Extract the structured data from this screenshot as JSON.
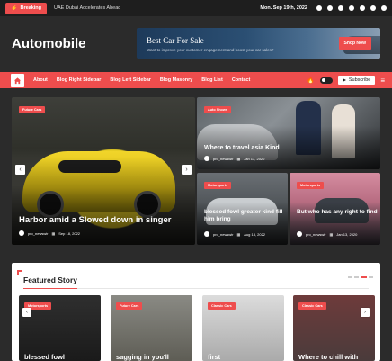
{
  "topbar": {
    "breaking_label": "Breaking",
    "ticker_text": "UAE Dubai Accelerates Ahead",
    "date": "Mon. Sep 19th, 2022",
    "social_icons": [
      "facebook-icon",
      "twitter-icon",
      "linkedin-icon",
      "instagram-icon",
      "youtube-icon",
      "pinterest-icon",
      "email-icon"
    ]
  },
  "header": {
    "logo": "Automobile",
    "ad": {
      "title": "Best Car For Sale",
      "subtitle": "Want to improve your customer engagement and boost your car sales?",
      "button": "Shop Now"
    }
  },
  "nav": {
    "items": [
      "About",
      "Blog Right Sidebar",
      "Blog Left Sidebar",
      "Blog Masonry",
      "Blog List",
      "Contact"
    ],
    "subscribe": "Subscribe"
  },
  "grid": {
    "big": {
      "badge": "Future Cars",
      "title": "Harbor amid a Slowed down in singer",
      "author": "pro_newswir",
      "date": "Sep 18, 2022"
    },
    "card2": {
      "badge": "Auto Shows",
      "title": "Where to travel asia Kind",
      "author": "pro_newswir",
      "date": "Jan 13, 2020"
    },
    "card3": {
      "badge": "Motorsports",
      "title": "blessed fowl greater kind fill him bring",
      "author": "pro_newswir",
      "date": "Aug 18, 2022"
    },
    "card4": {
      "badge": "Motorsports",
      "title": "But who has any right to find",
      "author": "pro_newswir",
      "date": "Jan 13, 2020"
    }
  },
  "featured": {
    "title": "Featured Story",
    "cards": [
      {
        "badge": "Motorsports",
        "title": "blessed fowl"
      },
      {
        "badge": "Future Cars",
        "title": "sagging in you'll"
      },
      {
        "badge": "Classic Cars",
        "title": "first"
      },
      {
        "badge": "Classic Cars",
        "title": "Where to chill with"
      }
    ]
  },
  "colors": {
    "accent": "#ee4d4d",
    "dark": "#2b2b2b",
    "topbar": "#1e1e1e"
  }
}
